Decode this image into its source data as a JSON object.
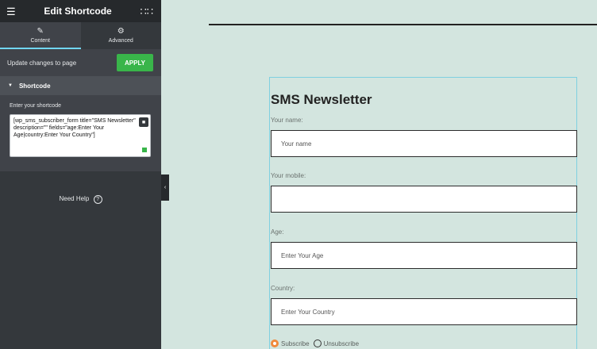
{
  "panel": {
    "title": "Edit Shortcode",
    "tabs": [
      {
        "label": "Content",
        "icon": "pencil-icon",
        "active": true
      },
      {
        "label": "Advanced",
        "icon": "gear-icon",
        "active": false
      }
    ],
    "update_text": "Update changes to page",
    "apply_label": "APPLY",
    "section_title": "Shortcode",
    "shortcode_label": "Enter your shortcode",
    "shortcode_value": "[wp_sms_subscriber_form title=\"SMS Newsletter\" description=\"\" fields=\"age:Enter Your Age|country:Enter Your Country\"]",
    "need_help": "Need Help",
    "help_icon_glyph": "?",
    "collapse_glyph": "‹"
  },
  "form": {
    "title": "SMS Newsletter",
    "name_label": "Your name:",
    "name_placeholder": "Your name",
    "mobile_label": "Your mobile:",
    "mobile_placeholder": "",
    "age_label": "Age:",
    "age_placeholder": "Enter Your Age",
    "country_label": "Country:",
    "country_placeholder": "Enter Your Country",
    "subscribe_label": "Subscribe",
    "unsubscribe_label": "Unsubscribe"
  },
  "colors": {
    "panel_bg": "#34383c",
    "apply_green": "#39b54a",
    "tab_active_underline": "#71d7f7",
    "preview_bg": "#d3e5df",
    "radio_checked": "#f08a3c"
  }
}
